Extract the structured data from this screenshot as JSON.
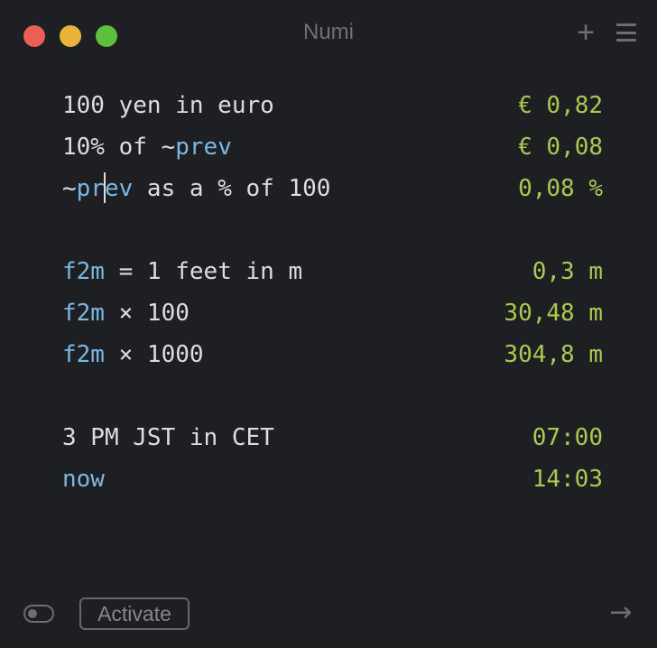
{
  "window": {
    "title": "Numi",
    "colors": {
      "close": "#ec5f57",
      "minimize": "#e9b43a",
      "maximize": "#5dbf3c"
    },
    "new_icon": "+",
    "menu_icon": "hamburger-menu"
  },
  "colors": {
    "background": "#1e1f22",
    "expression": "#dcdde0",
    "variable": "#7cb7e4",
    "result": "#a9c950"
  },
  "lines": [
    {
      "tokens": [
        {
          "t": "100 yen in euro",
          "k": "plain"
        }
      ],
      "result": "€ 0,82"
    },
    {
      "tokens": [
        {
          "t": "10% of ~",
          "k": "plain"
        },
        {
          "t": "prev",
          "k": "var"
        }
      ],
      "result": "€ 0,08"
    },
    {
      "tokens": [
        {
          "t": "~",
          "k": "plain"
        },
        {
          "t": "pr",
          "k": "var"
        },
        {
          "t": "",
          "k": "caret"
        },
        {
          "t": "ev",
          "k": "var"
        },
        {
          "t": " as a % of 100",
          "k": "plain"
        }
      ],
      "result": "0,08 %"
    },
    {
      "tokens": [],
      "result": ""
    },
    {
      "tokens": [
        {
          "t": "f2m",
          "k": "var"
        },
        {
          "t": " = 1 feet in m",
          "k": "plain"
        }
      ],
      "result": "0,3 m"
    },
    {
      "tokens": [
        {
          "t": "f2m",
          "k": "var"
        },
        {
          "t": " × 100",
          "k": "plain"
        }
      ],
      "result": "30,48 m"
    },
    {
      "tokens": [
        {
          "t": "f2m",
          "k": "var"
        },
        {
          "t": " × 1000",
          "k": "plain"
        }
      ],
      "result": "304,8 m"
    },
    {
      "tokens": [],
      "result": ""
    },
    {
      "tokens": [
        {
          "t": "3 PM JST in CET",
          "k": "plain"
        }
      ],
      "result": "07:00"
    },
    {
      "tokens": [
        {
          "t": "now",
          "k": "var"
        }
      ],
      "result": "14:03"
    }
  ],
  "footer": {
    "activate_label": "Activate",
    "toggle_state": "off",
    "arrow_icon": "→"
  }
}
